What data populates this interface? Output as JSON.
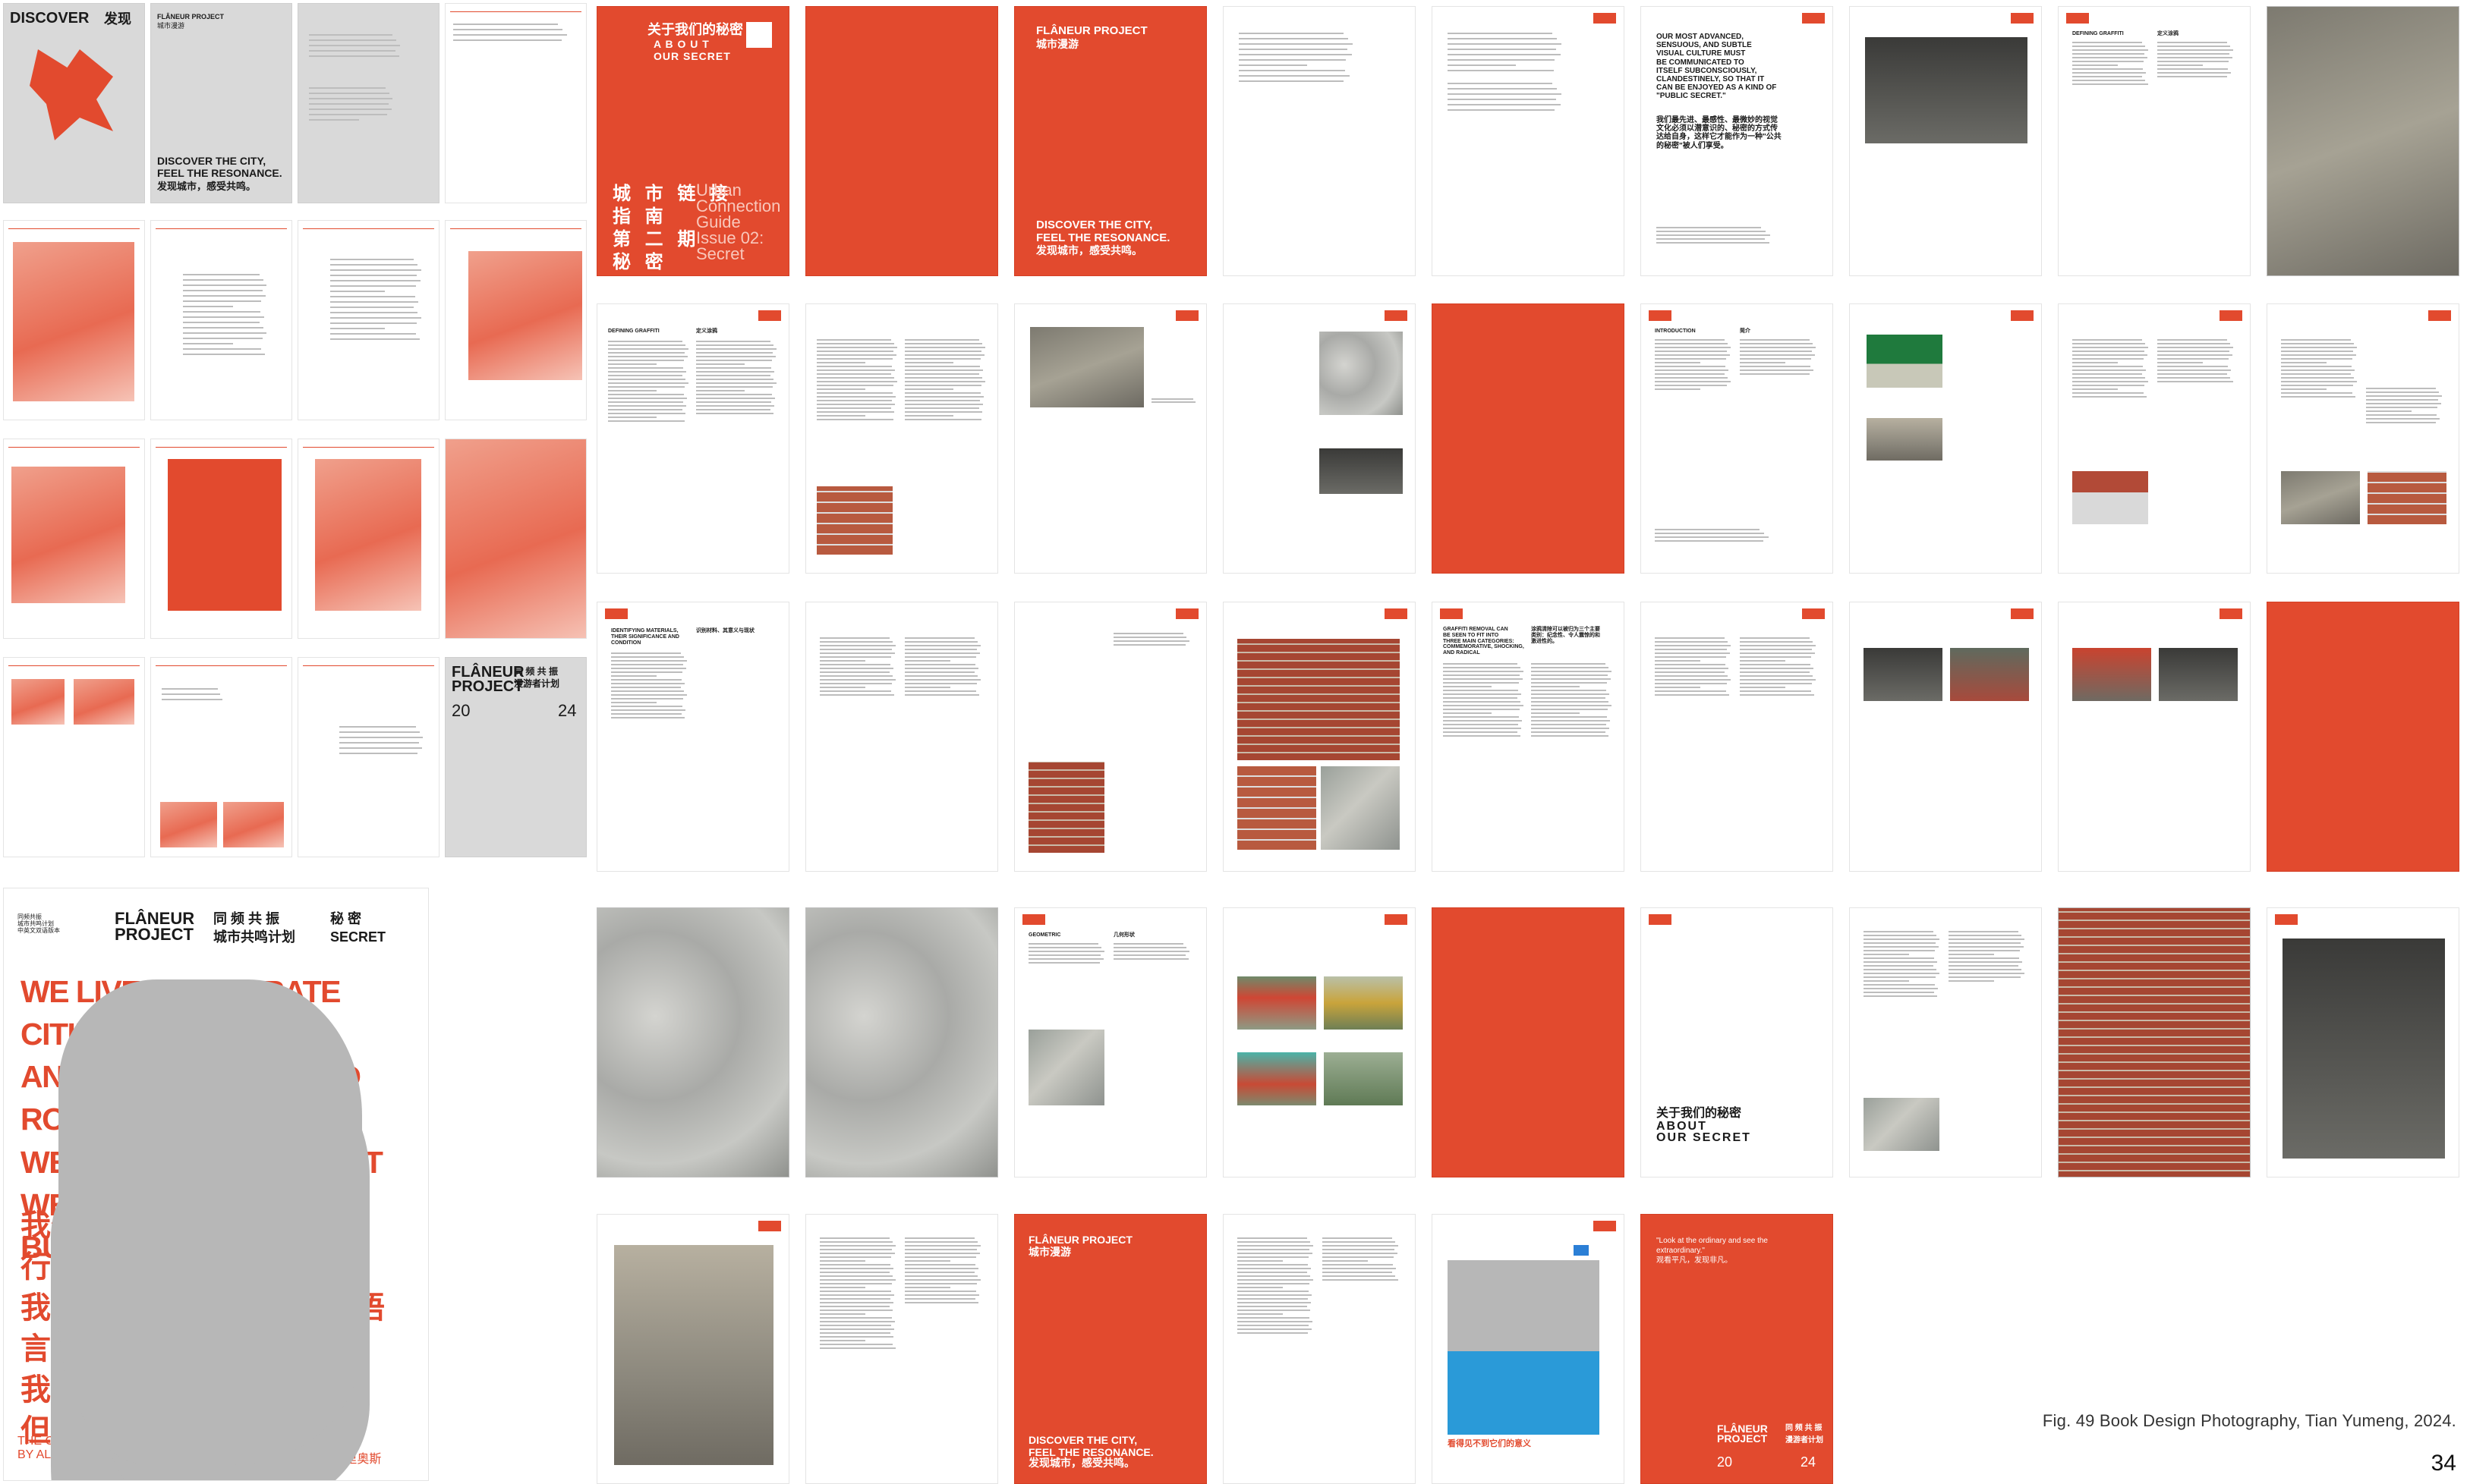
{
  "colors": {
    "accent": "#e24a2e",
    "pale": "#f3b4a6",
    "grey_page": "#d9d9d9",
    "placeholder_grey": "#b7b7b7"
  },
  "texts": {
    "discover": "DISCOVER",
    "faxian": "发现",
    "flaneur_project": "FLÂNEUR PROJECT",
    "chengshi_manyou": "城市漫游",
    "discover_city_en": "DISCOVER THE CITY,\nFEEL THE RESONANCE.",
    "discover_city_cn": "发现城市，感受共鸣。",
    "about_secret_cn": "关于我们的秘密",
    "about_secret_en": "A B O U T\nOUR SECRET",
    "about_secret_en_flat": "ABOUT\nOUR SECRET",
    "urban_cn_grid": "城 市 链 接\n指 南\n第 二 期\n秘 密",
    "urban_en": "Urban\nConnection\nGuide\nIssue 02:\nSecret",
    "advanced_en": "OUR MOST ADVANCED,\nSENSUOUS, AND SUBTLE\nVISUAL CULTURE MUST\nBE COMMUNICATED TO\nITSELF SUBCONSCIOUSLY,\nCLANDESTINELY, SO THAT IT\nCAN BE ENJOYED AS A KIND OF\n\"PUBLIC SECRET.\"",
    "advanced_cn": "我们最先进、最感性、最微妙的视觉\n文化必须以潜意识的、秘密的方式传\n达给自身，这样它才能作为一种\"公共\n的秘密\"被人们享受。",
    "defining_graffiti": "DEFINING GRAFFITI",
    "defining_graffiti_cn": "定义涂鸦",
    "introduction": "INTRODUCTION",
    "introduction_cn": "简介",
    "identifying_materials": "IDENTIFYING MATERIALS,\nTHEIR SIGNIFICANCE AND\nCONDITION",
    "identifying_materials_cn": "识别材料、其意义与现状",
    "graffiti_removal": "GRAFFITI REMOVAL CAN\nBE SEEN TO FIT INTO\nTHREE MAIN CATEGORIES:\nCOMMEMORATIVE, SHOCKING,\nAND RADICAL",
    "graffiti_removal_cn": "涂鸦清除可以被归为三个主要\n类别：纪念性、令人震惊的和\n激进性的。",
    "geometric": "GEOMETRIC",
    "geometric_cn": "几何形状",
    "flaneur_stack": "FLÂNEUR\nPROJECT",
    "tongpin_a": "同 频 共 振",
    "tongpin_b": "漫游者计划",
    "year_a": "20",
    "year_b": "24",
    "poster_tongpin_a": "同 频 共 振",
    "poster_tongpin_b": "城市共鸣计划",
    "poster_mimi": "秘   密",
    "poster_secret": "SECRET",
    "poster_corner": "同频共振\n城市共鸣计划\n中英文双语版本",
    "poster_en": "WE LIVE IN SEPARATE CITIES\nAND WE WALK DIVIDED ROADS.\nWE SPEAK WORDS THAT\nWE DO NOT SHARE\nBUT WE WILL MEET UP.",
    "poster_cn": "我们生活在不同的城市里\n行走在分开的道路上。\n我们说着彼此无法交流的语言，\n我们无法相互理解\n但我们终将相遇。",
    "poster_bottom_left": "THE CITY\nBY ALBERTO RIOS",
    "poster_bottom_right": "《城市》\n阿尔贝托·里奥斯",
    "look_ordinary": "\"Look at the ordinary and see the\nextraordinary.\"\n观看平凡，发现非凡。",
    "significance": "看得见不到它们的意义",
    "caption": "Fig. 49 Book Design Photography, Tian Yumeng, 2024.",
    "page_number": "34"
  }
}
